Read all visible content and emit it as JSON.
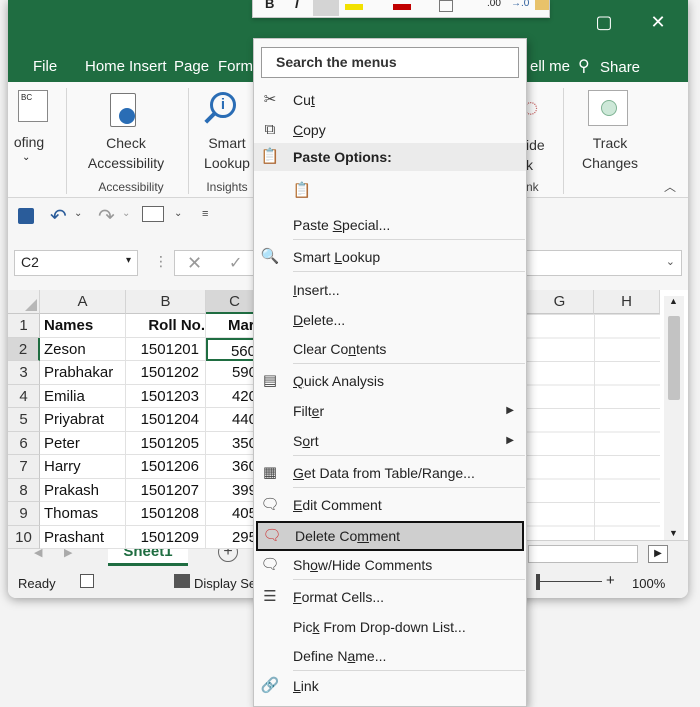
{
  "excel": {
    "ribbon_tabs": [
      "File",
      "Home",
      "Insert",
      "Page",
      "Form",
      "ell me"
    ],
    "share_label": "Share",
    "ribbon": {
      "proofing_label": "ofing",
      "check_accessibility": [
        "Check",
        "Accessibility"
      ],
      "accessibility_group": "Accessibility",
      "smart_lookup": [
        "Smart",
        "Lookup"
      ],
      "insights_group": "Insights",
      "hide_ink": [
        "ide",
        "k"
      ],
      "ink_group": "nk",
      "track_changes": [
        "Track",
        "Changes"
      ]
    },
    "name_box": "C2",
    "columns": [
      "A",
      "B",
      "C",
      "G",
      "H"
    ],
    "rows": [
      "1",
      "2",
      "3",
      "4",
      "5",
      "6",
      "7",
      "8",
      "9",
      "10"
    ],
    "table": [
      [
        "Names",
        "Roll No.",
        "Mark"
      ],
      [
        "Zeson",
        "1501201",
        "560"
      ],
      [
        "Prabhakar",
        "1501202",
        "590"
      ],
      [
        "Emilia",
        "1501203",
        "420"
      ],
      [
        "Priyabrat",
        "1501204",
        "440"
      ],
      [
        "Peter",
        "1501205",
        "350"
      ],
      [
        "Harry",
        "1501206",
        "360"
      ],
      [
        "Prakash",
        "1501207",
        "399"
      ],
      [
        "Thomas",
        "1501208",
        "405"
      ],
      [
        "Prashant",
        "1501209",
        "295"
      ]
    ],
    "sheet_tab": "Sheet1",
    "status_ready": "Ready",
    "status_display": "Display Se",
    "zoom": "100%",
    "minus": "–",
    "plus": "+"
  },
  "mini_toolbar": {
    "bold": "B",
    "italic": "I",
    "decimal_inc": ".00",
    "decimal_dec": "→.0"
  },
  "context_menu": {
    "search_placeholder": "Search the menus",
    "items": {
      "cut": {
        "pre": "Cu",
        "key": "t",
        "post": ""
      },
      "copy": {
        "pre": "",
        "key": "C",
        "post": "opy"
      },
      "paste_options": "Paste Options:",
      "paste_special": {
        "pre": "Paste ",
        "key": "S",
        "post": "pecial..."
      },
      "smart_lookup": {
        "pre": "Smart ",
        "key": "L",
        "post": "ookup"
      },
      "insert": {
        "pre": "",
        "key": "I",
        "post": "nsert..."
      },
      "delete": {
        "pre": "",
        "key": "D",
        "post": "elete..."
      },
      "clear_contents": {
        "pre": "Clear Co",
        "key": "n",
        "post": "tents"
      },
      "quick_analysis": {
        "pre": "",
        "key": "Q",
        "post": "uick Analysis"
      },
      "filter": {
        "pre": "Filt",
        "key": "e",
        "post": "r"
      },
      "sort": {
        "pre": "S",
        "key": "o",
        "post": "rt"
      },
      "get_data": {
        "pre": "",
        "key": "G",
        "post": "et Data from Table/Range..."
      },
      "edit_comment": {
        "pre": "",
        "key": "E",
        "post": "dit Comment"
      },
      "delete_comment": {
        "pre": "Delete Co",
        "key": "m",
        "post": "ment"
      },
      "show_hide_comments": {
        "pre": "Sh",
        "key": "o",
        "post": "w/Hide Comments"
      },
      "format_cells": {
        "pre": "",
        "key": "F",
        "post": "ormat Cells..."
      },
      "pick_from_list": {
        "pre": "Pic",
        "key": "k",
        "post": " From Drop-down List..."
      },
      "define_name": {
        "pre": "Define N",
        "key": "a",
        "post": "me..."
      },
      "link": {
        "pre": "",
        "key": "L",
        "post": "ink"
      }
    },
    "highlighted_item": "Delete Comment"
  }
}
